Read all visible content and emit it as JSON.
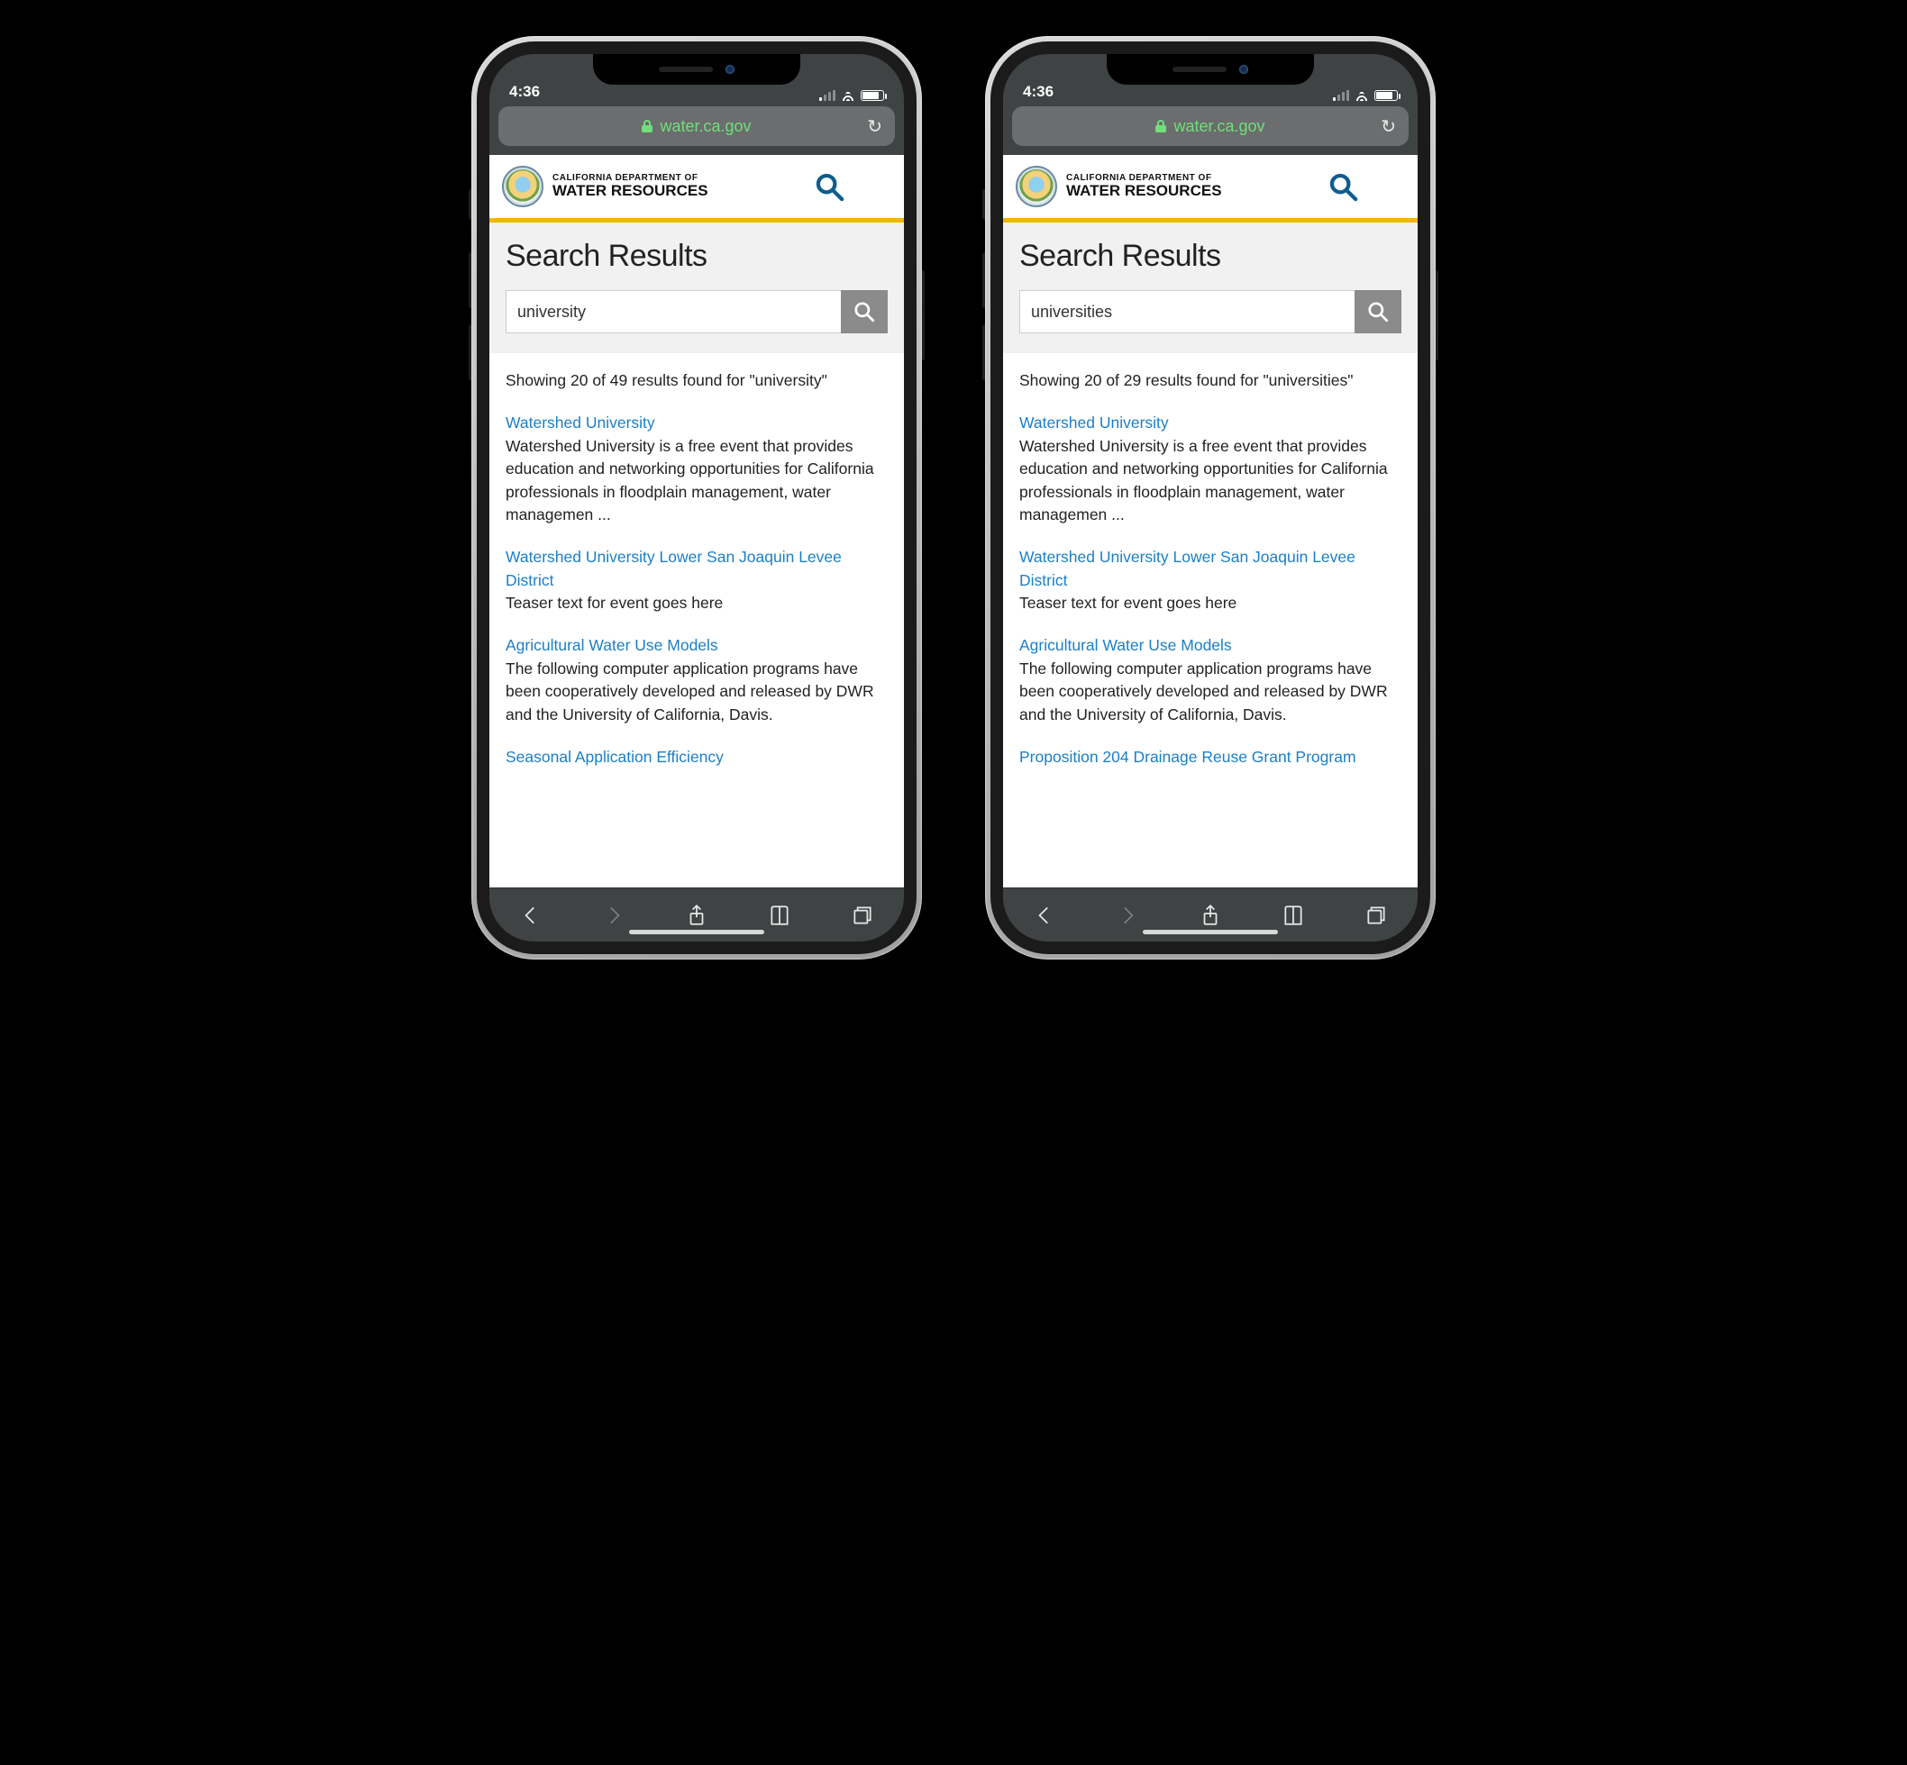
{
  "status": {
    "time": "4:36"
  },
  "browser": {
    "domain": "water.ca.gov"
  },
  "site": {
    "dept_line": "CALIFORNIA  DEPARTMENT OF",
    "dept_name": "WATER RESOURCES"
  },
  "page_title": "Search Results",
  "phones": [
    {
      "query": "university",
      "summary": "Showing 20 of 49 results found for \"university\"",
      "results": [
        {
          "title": "Watershed University",
          "snippet": "Watershed University is a free event that provides education and networking opportunities for California professionals in floodplain management, water managemen ..."
        },
        {
          "title": "Watershed University Lower San Joaquin Levee District",
          "snippet": "Teaser text for event goes here"
        },
        {
          "title": "Agricultural Water Use Models",
          "snippet": "The following computer application programs have been cooperatively developed and released by DWR and the University of California, Davis."
        },
        {
          "title": "Seasonal Application Efficiency",
          "snippet": ""
        }
      ]
    },
    {
      "query": "universities",
      "summary": "Showing 20 of 29 results found for \"universities\"",
      "results": [
        {
          "title": "Watershed University",
          "snippet": "Watershed University is a free event that provides education and networking opportunities for California professionals in floodplain management, water managemen ..."
        },
        {
          "title": "Watershed University Lower San Joaquin Levee District",
          "snippet": "Teaser text for event goes here"
        },
        {
          "title": "Agricultural Water Use Models",
          "snippet": "The following computer application programs have been cooperatively developed and released by DWR and the University of California, Davis."
        },
        {
          "title": "Proposition 204 Drainage Reuse Grant Program",
          "snippet": ""
        }
      ]
    }
  ]
}
